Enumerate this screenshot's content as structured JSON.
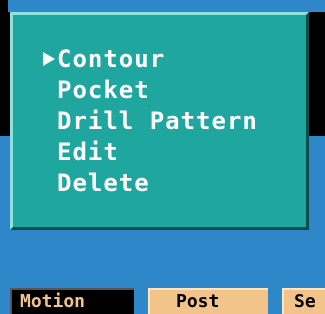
{
  "menu": {
    "items": [
      {
        "label": "Contour",
        "selected": true
      },
      {
        "label": "Pocket"
      },
      {
        "label": "Drill Pattern"
      },
      {
        "label": "Edit"
      },
      {
        "label": "Delete"
      }
    ]
  },
  "softkeys": {
    "motion": "Motion",
    "post": "Post",
    "next": "Se"
  },
  "colors": {
    "menu_bg": "#1fa79f",
    "workspace_bg": "#2e87c8",
    "softkey_bg": "#f2c48a",
    "active_softkey_bg": "#000000",
    "text": "#ffffff"
  },
  "icons": {
    "selection_cursor": "cursor-arrow-icon"
  }
}
